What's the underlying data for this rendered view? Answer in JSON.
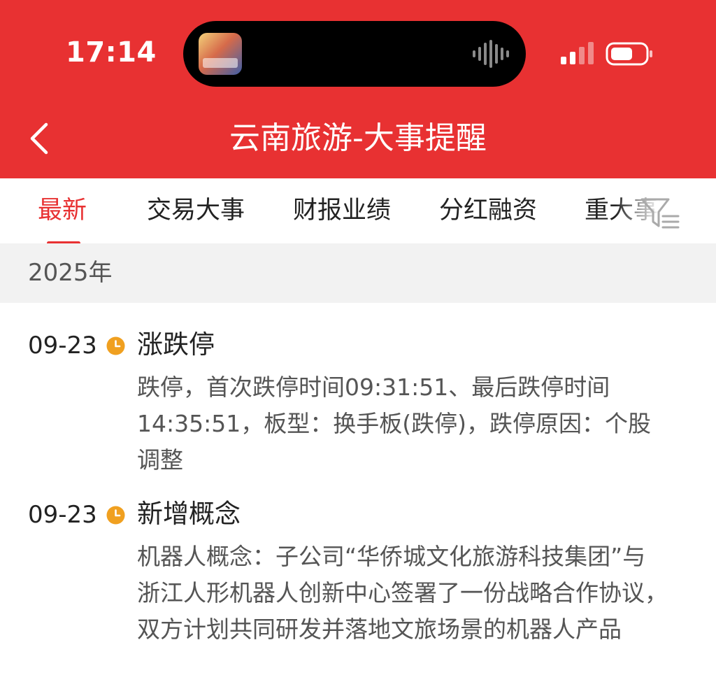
{
  "status_bar": {
    "time": "17:14"
  },
  "header": {
    "title": "云南旅游-大事提醒",
    "back_icon": "chevron-left-icon"
  },
  "tabs": [
    {
      "label": "最新",
      "active": true
    },
    {
      "label": "交易大事",
      "active": false
    },
    {
      "label": "财报业绩",
      "active": false
    },
    {
      "label": "分红融资",
      "active": false
    },
    {
      "label": "重大事项",
      "active": false
    }
  ],
  "filter_icon": "filter-icon",
  "year_section": {
    "label": "2025年"
  },
  "events": [
    {
      "date": "09-23",
      "title": "涨跌停",
      "description": "跌停，首次跌停时间09:31:51、最后跌停时间14:35:51，板型：换手板(跌停)，跌停原因：个股调整"
    },
    {
      "date": "09-23",
      "title": "新增概念",
      "description": "机器人概念：子公司“华侨城文化旅游科技集团”与浙江人形机器人创新中心签署了一份战略合作协议，双方计划共同研发并落地文旅场景的机器人产品"
    }
  ],
  "colors": {
    "brand_red": "#e83132",
    "clock_orange": "#f0a020",
    "section_bg": "#f2f2f2"
  }
}
